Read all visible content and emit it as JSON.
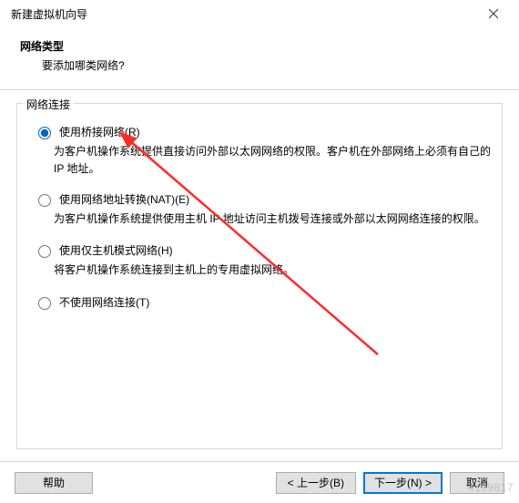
{
  "window": {
    "title": "新建虚拟机向导"
  },
  "header": {
    "title": "网络类型",
    "subtitle": "要添加哪类网络?"
  },
  "group": {
    "legend": "网络连接"
  },
  "options": {
    "bridged": {
      "label": "使用桥接网络(R)",
      "desc": "为客户机操作系统提供直接访问外部以太网网络的权限。客户机在外部网络上必须有自己的 IP 地址。",
      "checked": true
    },
    "nat": {
      "label": "使用网络地址转换(NAT)(E)",
      "desc": "为客户机操作系统提供使用主机 IP 地址访问主机拨号连接或外部以太网网络连接的权限。",
      "checked": false
    },
    "hostonly": {
      "label": "使用仅主机模式网络(H)",
      "desc": "将客户机操作系统连接到主机上的专用虚拟网络。",
      "checked": false
    },
    "none": {
      "label": "不使用网络连接(T)",
      "checked": false
    }
  },
  "buttons": {
    "help": "帮助",
    "back": "< 上一步(B)",
    "next": "下一步(N) >",
    "cancel": "取消"
  },
  "watermark": "4199817"
}
